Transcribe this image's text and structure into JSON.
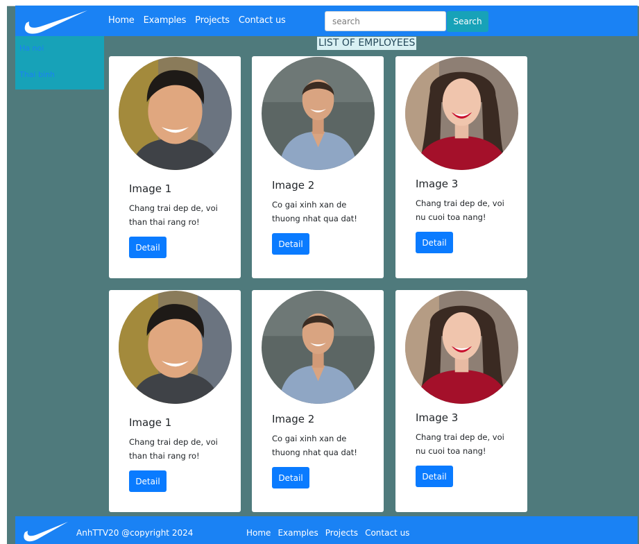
{
  "header": {
    "nav": [
      "Home",
      "Examples",
      "Projects",
      "Contact us"
    ],
    "search_placeholder": "search",
    "search_button": "Search"
  },
  "sidebar": {
    "items": [
      "Ha noi",
      "Thai binh"
    ]
  },
  "main": {
    "title": "LIST OF EMPLOYEES",
    "cards": [
      {
        "title": "Image 1",
        "text": "Chang trai dep de, voi than thai rang ro!",
        "button": "Detail",
        "photo": "smiling-young-man-portrait"
      },
      {
        "title": "Image 2",
        "text": "Co gai xinh xan de thuong nhat qua dat!",
        "button": "Detail",
        "photo": "man-blue-shirt-portrait"
      },
      {
        "title": "Image 3",
        "text": "Chang trai dep de, voi nu cuoi toa nang!",
        "button": "Detail",
        "photo": "laughing-woman-red-top-portrait"
      },
      {
        "title": "Image 1",
        "text": "Chang trai dep de, voi than thai rang ro!",
        "button": "Detail",
        "photo": "smiling-young-man-portrait"
      },
      {
        "title": "Image 2",
        "text": "Co gai xinh xan de thuong nhat qua dat!",
        "button": "Detail",
        "photo": "man-blue-shirt-portrait"
      },
      {
        "title": "Image 3",
        "text": "Chang trai dep de, voi nu cuoi toa nang!",
        "button": "Detail",
        "photo": "laughing-woman-red-top-portrait"
      }
    ]
  },
  "footer": {
    "copyright": "AnhTTV20 @copyright 2024",
    "nav": [
      "Home",
      "Examples",
      "Projects",
      "Contact us"
    ]
  },
  "colors": {
    "brand_blue": "#1a82f4",
    "page_bg": "#4f7a7c",
    "sidebar_bg": "#17a2b8",
    "button_blue": "#0a7bff",
    "search_button": "#17a2b8"
  }
}
